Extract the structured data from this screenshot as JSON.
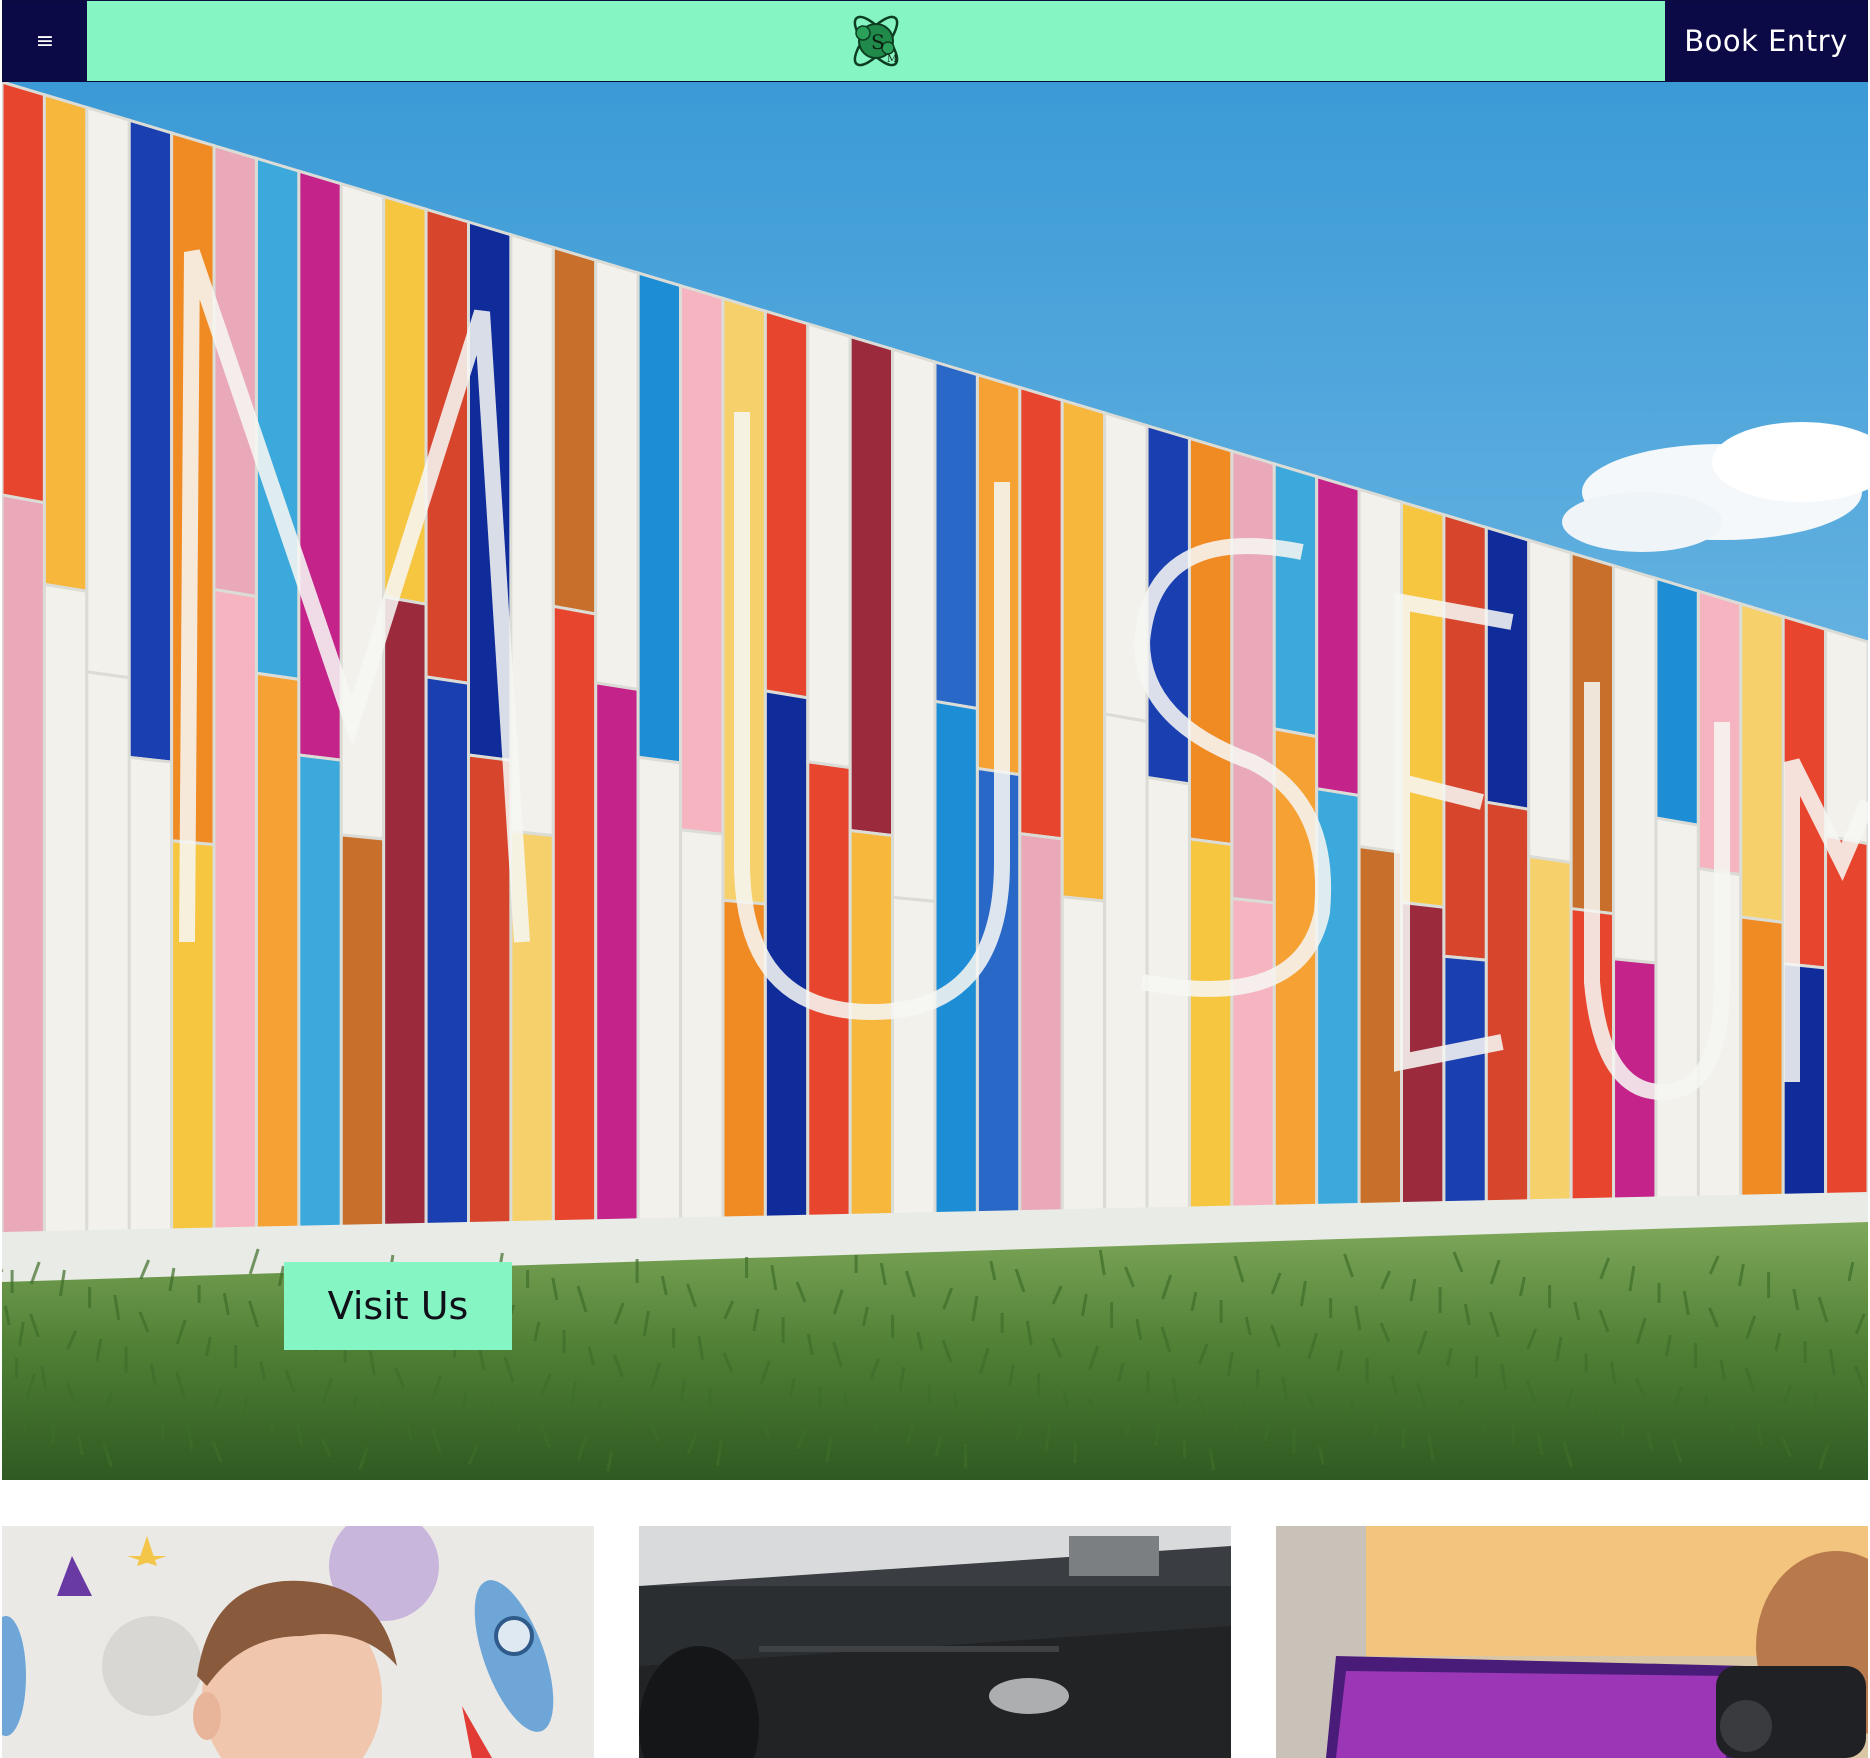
{
  "header": {
    "menu_icon": "hamburger-menu-icon",
    "menu_glyph": "≡",
    "logo_icon": "atom-logo-icon",
    "book_label": "Book Entry"
  },
  "hero": {
    "image": "colorful-museum-facade-photo",
    "visit_label": "Visit Us"
  },
  "cards": [
    {
      "image": "child-with-space-rocket-wallpaper-photo"
    },
    {
      "image": "dark-glass-exhibit-case-photo"
    },
    {
      "image": "vr-headset-visitor-photo"
    }
  ],
  "colors": {
    "accent_mint": "#86f5c4",
    "navy": "#0c0a46"
  }
}
